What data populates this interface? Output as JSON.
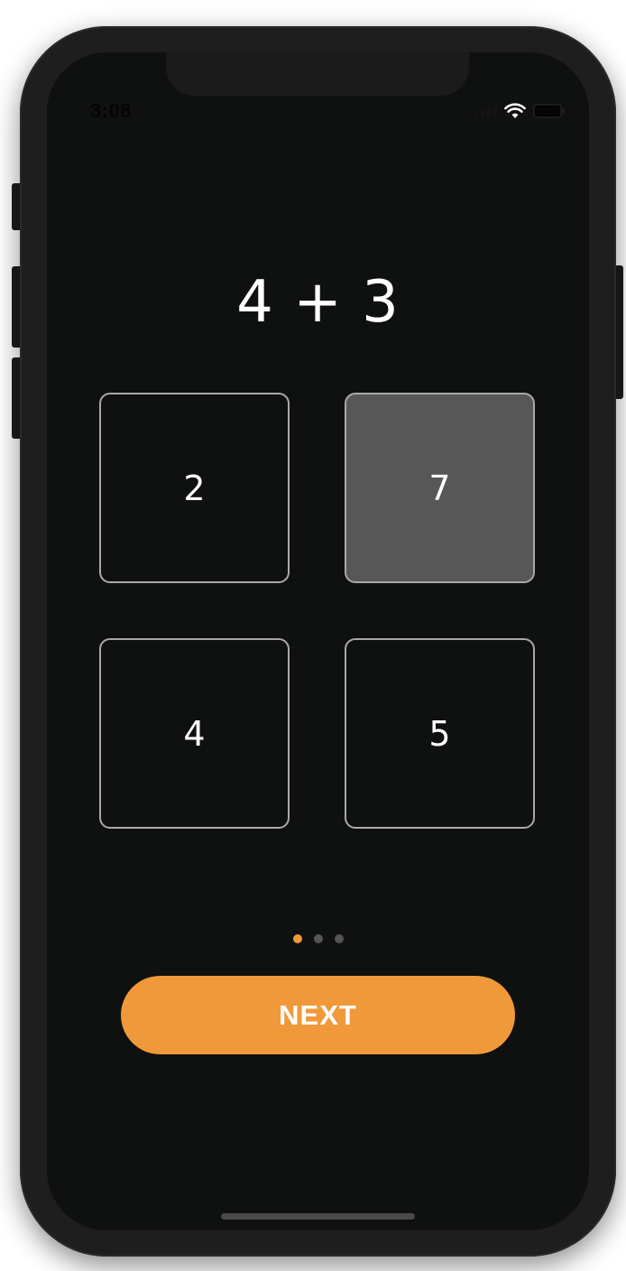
{
  "status_bar": {
    "time": "3:08"
  },
  "quiz": {
    "question": "4 + 3",
    "answers": [
      {
        "label": "2",
        "selected": false
      },
      {
        "label": "7",
        "selected": true
      },
      {
        "label": "4",
        "selected": false
      },
      {
        "label": "5",
        "selected": false
      }
    ]
  },
  "pagination": {
    "total": 3,
    "current": 1
  },
  "next_button": {
    "label": "NEXT"
  },
  "colors": {
    "accent": "#f0993a",
    "background": "#0f1110",
    "selected_answer": "#575757",
    "answer_border": "#a9a9a9"
  }
}
